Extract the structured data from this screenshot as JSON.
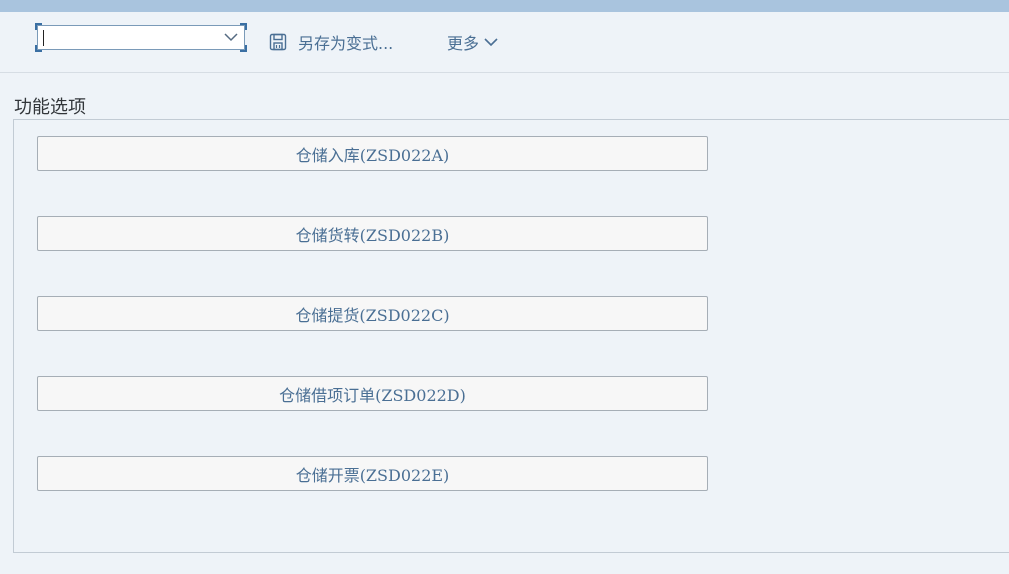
{
  "toolbar": {
    "variant_select_value": "",
    "save_as_variant_label": "另存为变式...",
    "more_label": "更多"
  },
  "section": {
    "title": "功能选项"
  },
  "buttons": [
    {
      "label": "仓储入库(ZSD022A)"
    },
    {
      "label": "仓储货转(ZSD022B)"
    },
    {
      "label": "仓储提货(ZSD022C)"
    },
    {
      "label": "仓储借项订单(ZSD022D)"
    },
    {
      "label": "仓储开票(ZSD022E)"
    }
  ],
  "icons": {
    "save": "save-icon",
    "dropdown": "chevron-down-icon"
  },
  "colors": {
    "top_strip": "#a9c4de",
    "background": "#eef3f8",
    "link_text": "#4a6f94"
  }
}
